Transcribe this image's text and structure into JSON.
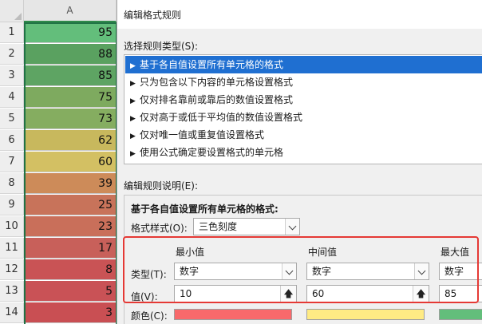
{
  "sheet": {
    "column_header": "A",
    "rows": [
      {
        "num": "1",
        "value": "95",
        "color": "#63be7b"
      },
      {
        "num": "2",
        "value": "88",
        "color": "#5aa160"
      },
      {
        "num": "3",
        "value": "85",
        "color": "#5ea463"
      },
      {
        "num": "4",
        "value": "75",
        "color": "#7eaa5f"
      },
      {
        "num": "5",
        "value": "73",
        "color": "#85ad60"
      },
      {
        "num": "6",
        "value": "62",
        "color": "#c8b85d"
      },
      {
        "num": "7",
        "value": "60",
        "color": "#d3c063"
      },
      {
        "num": "8",
        "value": "39",
        "color": "#cd8b59"
      },
      {
        "num": "9",
        "value": "25",
        "color": "#c8735a"
      },
      {
        "num": "10",
        "value": "23",
        "color": "#c96f5a"
      },
      {
        "num": "11",
        "value": "17",
        "color": "#c8605a"
      },
      {
        "num": "12",
        "value": "8",
        "color": "#c95355"
      },
      {
        "num": "13",
        "value": "5",
        "color": "#c95256"
      },
      {
        "num": "14",
        "value": "3",
        "color": "#c94f53"
      }
    ]
  },
  "dialog": {
    "title": "编辑格式规则",
    "select_type_label": "选择规则类型(S):",
    "rule_types": [
      {
        "label": "基于各自值设置所有单元格的格式",
        "selected": true
      },
      {
        "label": "只为包含以下内容的单元格设置格式",
        "selected": false
      },
      {
        "label": "仅对排名靠前或靠后的数值设置格式",
        "selected": false
      },
      {
        "label": "仅对高于或低于平均值的数值设置格式",
        "selected": false
      },
      {
        "label": "仅对唯一值或重复值设置格式",
        "selected": false
      },
      {
        "label": "使用公式确定要设置格式的单元格",
        "selected": false
      }
    ],
    "edit_desc_label": "编辑规则说明(E):",
    "desc_heading": "基于各自值设置所有单元格的格式:",
    "format_style_label": "格式样式(O):",
    "format_style_value": "三色刻度",
    "min_heading": "最小值",
    "mid_heading": "中间值",
    "max_heading": "最大值",
    "type_label": "类型(T):",
    "value_label": "值(V):",
    "color_label": "颜色(C):",
    "min_type": "数字",
    "mid_type": "数字",
    "max_type": "数字",
    "min_value": "10",
    "mid_value": "60",
    "max_value": "85",
    "min_color": "#f8696b",
    "mid_color": "#ffeb84",
    "max_color": "#63be7b"
  }
}
